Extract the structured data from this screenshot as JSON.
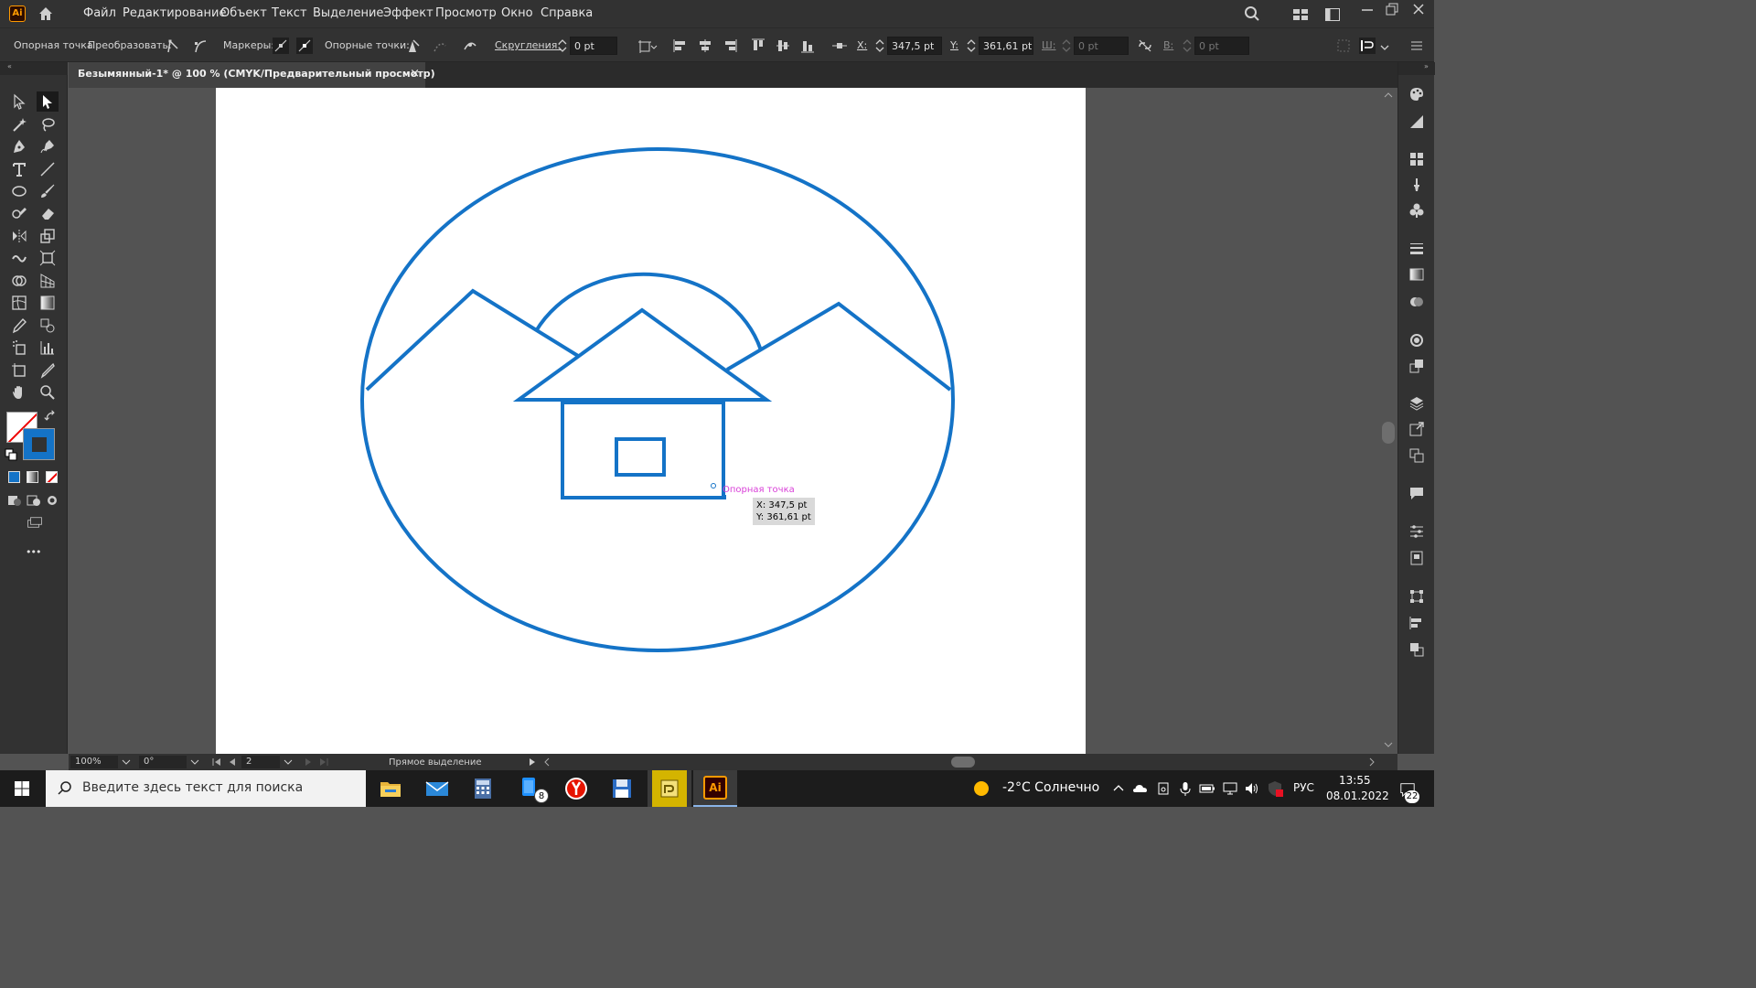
{
  "app": {
    "logo": "Ai",
    "home_icon": "home-icon"
  },
  "menu": [
    "Файл",
    "Редактирование",
    "Объект",
    "Текст",
    "Выделение",
    "Эффект",
    "Просмотр",
    "Окно",
    "Справка"
  ],
  "control_bar": {
    "anchor_label": "Опорная точка",
    "convert_label": "Преобразовать:",
    "handles_label": "Маркеры:",
    "anchors_label": "Опорные точки:",
    "corners_label": "Скругления:",
    "corners_value": "0 pt",
    "x_label": "X:",
    "x_value": "347,5 pt",
    "y_label": "Y:",
    "y_value": "361,61 pt",
    "w_label": "Ш:",
    "w_value": "0 pt",
    "h_label": "В:",
    "h_value": "0 pt"
  },
  "document_tab": {
    "title": "Безымянный-1* @ 100 % (CMYK/Предварительный просмотр)",
    "close": "×"
  },
  "artwork": {
    "stroke_color": "#1473c7"
  },
  "tooltip": {
    "label": "Опорная точка",
    "x": "X: 347,5 pt",
    "y": "Y: 361,61 pt"
  },
  "status_bar": {
    "zoom": "100%",
    "rotation": "0°",
    "artboard": "2",
    "tool": "Прямое выделение"
  },
  "toolbar": {
    "more": "•••"
  },
  "taskbar": {
    "search_placeholder": "Введите здесь текст для поиска",
    "mail_badge": "8",
    "weather": "-2°C  Солнечно",
    "language": "РУС",
    "time": "13:55",
    "date": "08.01.2022",
    "notifications": "22"
  }
}
